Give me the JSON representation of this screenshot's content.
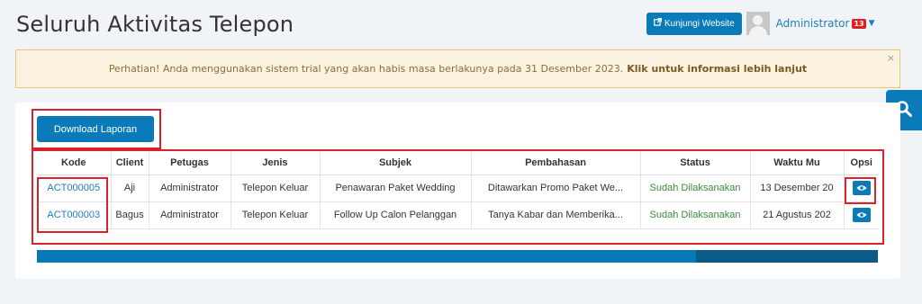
{
  "header": {
    "title": "Seluruh Aktivitas Telepon",
    "visit_label": "Kunjungi Website",
    "user_name": "Administrator",
    "notif_count": "13"
  },
  "alert": {
    "text": "Perhatian! Anda menggunakan sistem trial yang akan habis masa berlakunya pada 31 Desember 2023.",
    "link": "Klik untuk informasi lebih lanjut",
    "close": "×"
  },
  "toolbar": {
    "download_label": "Download Laporan"
  },
  "table": {
    "columns": [
      "Kode",
      "Client",
      "Petugas",
      "Jenis",
      "Subjek",
      "Pembahasan",
      "Status",
      "Waktu Mu",
      "Opsi"
    ],
    "rows": [
      [
        "ACT000005",
        "Aji",
        "Administrator",
        "Telepon Keluar",
        "Penawaran Paket Wedding",
        "Ditawarkan Promo Paket We...",
        "Sudah Dilaksanakan",
        "13 Desember 20"
      ],
      [
        "ACT000003",
        "Bagus",
        "Administrator",
        "Telepon Keluar",
        "Follow Up Calon Pelanggan",
        "Tanya Kabar dan Memberika...",
        "Sudah Dilaksanakan",
        "21 Agustus 202"
      ]
    ]
  },
  "colors": {
    "primary": "#0a7ab8",
    "highlight": "#d9222b",
    "status": "#3d8b3d"
  },
  "icons": [
    "external-link-icon",
    "avatar-icon",
    "caret-down-icon",
    "close-icon",
    "search-icon",
    "eye-icon"
  ]
}
